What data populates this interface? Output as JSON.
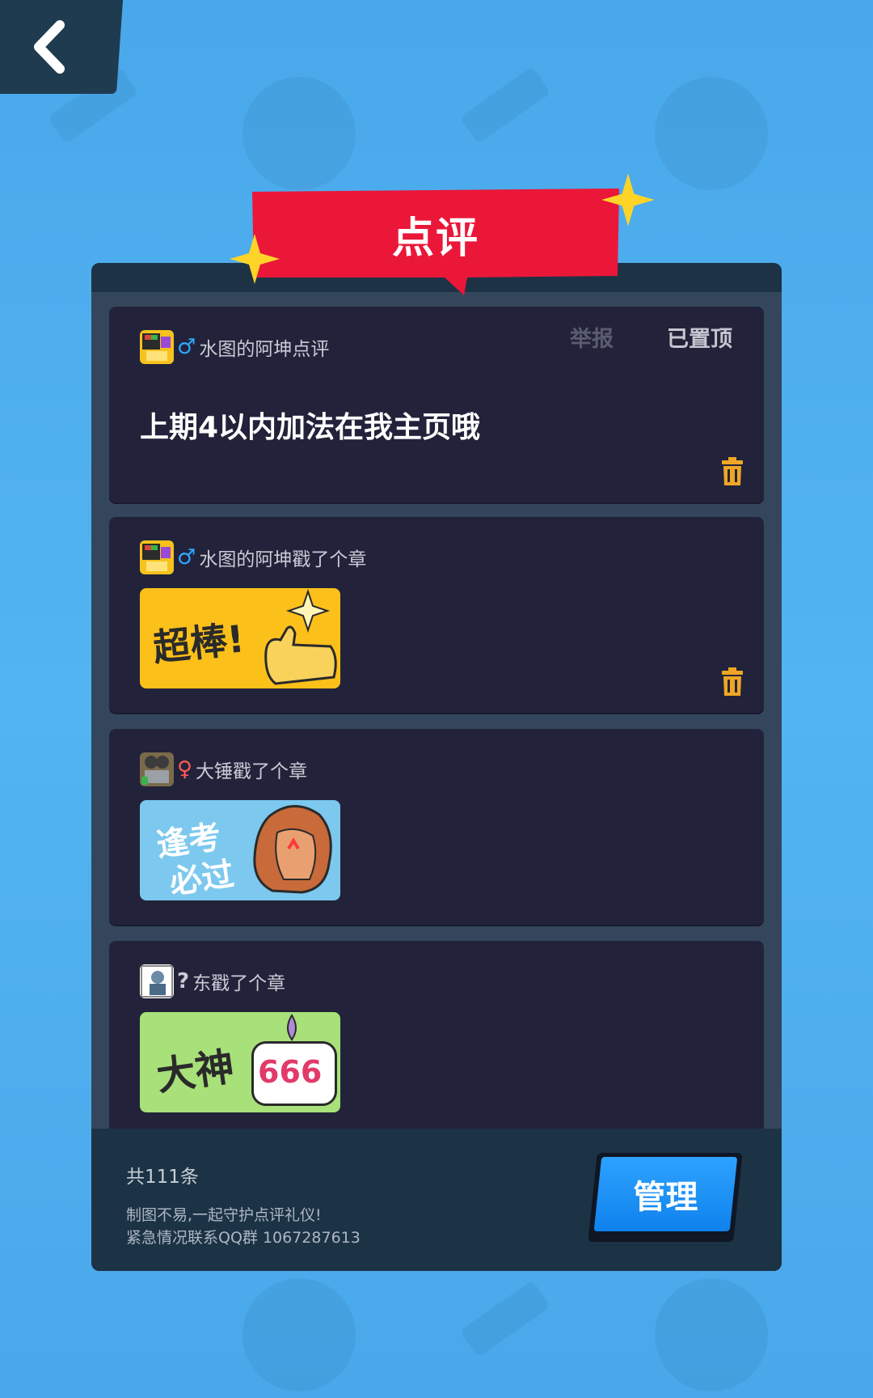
{
  "header": {
    "back_icon": "chevron-left-icon"
  },
  "title": "点评",
  "reviews": [
    {
      "type": "comment",
      "username": "水图的阿坤点评",
      "gender_symbol": "♂",
      "gender_color": "#2fa7ff",
      "text": "上期4以内加法在我主页哦",
      "report_label": "举报",
      "pinned_label": "已置顶"
    },
    {
      "type": "stamp",
      "username": "水图的阿坤戳了个章",
      "gender_symbol": "♂",
      "gender_color": "#2fa7ff",
      "sticker_text": "超棒!"
    },
    {
      "type": "stamp",
      "username": "大锤戳了个章",
      "gender_symbol": "♀",
      "gender_color": "#ff5a5a",
      "sticker_text_line1": "逢考",
      "sticker_text_line2": "必过"
    },
    {
      "type": "stamp",
      "username": "东戳了个章",
      "gender_symbol": "?",
      "gender_color": "#c9cbd6",
      "sticker_text": "大神",
      "sticker_badge": "666"
    }
  ],
  "footer": {
    "count": "共111条",
    "note_line1": "制图不易,一起守护点评礼仪!",
    "note_line2": "紧急情况联系QQ群 1067287613",
    "manage_label": "管理"
  },
  "colors": {
    "background": "#4aa8ea",
    "banner_red": "#ea1739",
    "accent_orange": "#f0a624",
    "button_blue": "#1a8cf2",
    "card_bg": "#22233a"
  }
}
